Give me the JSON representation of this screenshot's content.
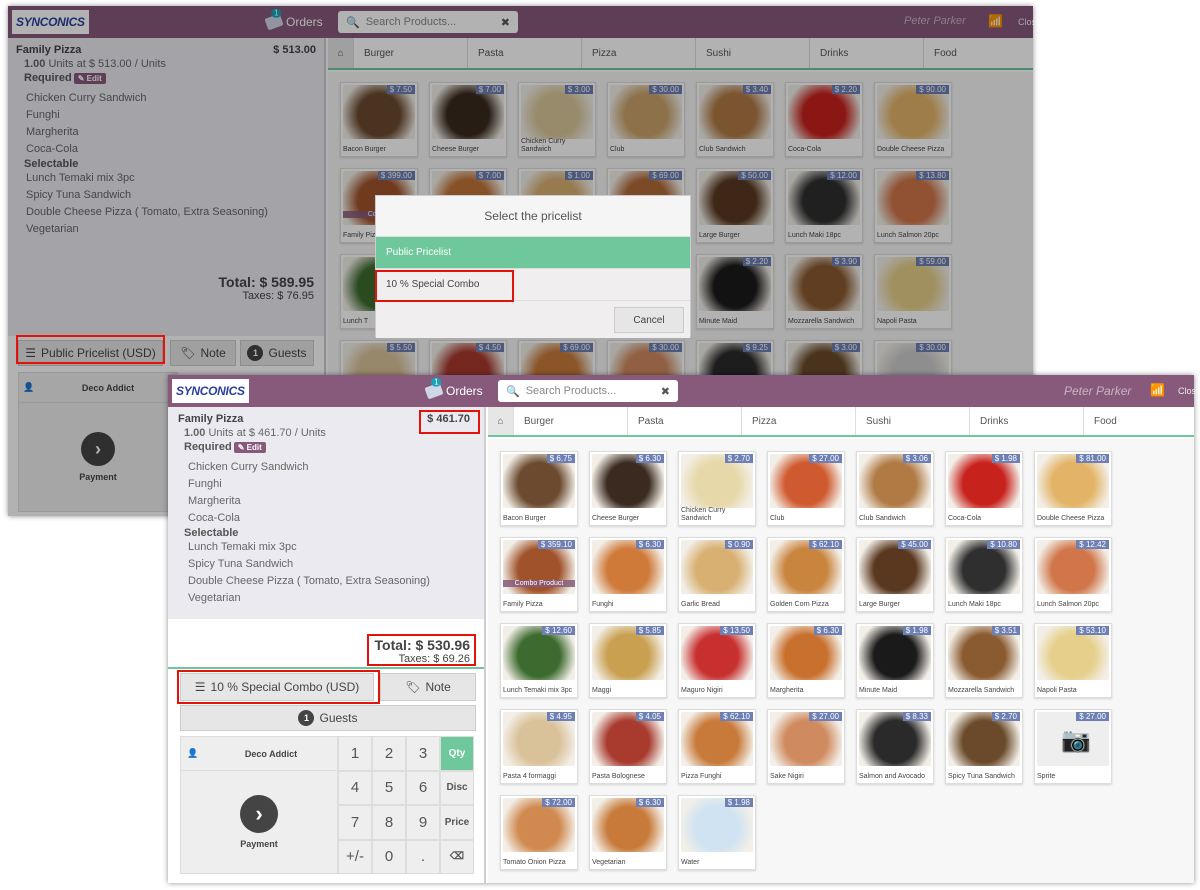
{
  "back": {
    "logo": "SYNCONICS",
    "orders": "Orders",
    "orders_badge": "1",
    "search_placeholder": "Search Products...",
    "user": "Peter Parker",
    "close": "Clos",
    "line": {
      "name": "Family Pizza",
      "price": "$ 513.00",
      "qty": "1.00",
      "units": " Units at $ 513.00 / Units"
    },
    "required": "Required",
    "edit": "Edit",
    "req_items": [
      "Chicken Curry Sandwich",
      "Funghi",
      "Margherita",
      "Coca-Cola"
    ],
    "selectable": "Selectable",
    "sel_items": [
      "Lunch Temaki mix 3pc",
      "Spicy Tuna Sandwich",
      "Double Cheese Pizza ( Tomato, Extra Seasoning)",
      "Vegetarian"
    ],
    "total": "Total: $ 589.95",
    "taxes": "Taxes: $ 76.95",
    "pricelist_btn": "Public Pricelist (USD)",
    "note": "Note",
    "guests_count": "1",
    "guests": "Guests",
    "customer": "Deco Addict",
    "payment": "Payment",
    "categories": [
      "Burger",
      "Pasta",
      "Pizza",
      "Sushi",
      "Drinks",
      "Food"
    ],
    "products": [
      {
        "name": "Bacon Burger",
        "price": "$ 7.50",
        "color": "#6b4a2f"
      },
      {
        "name": "Cheese Burger",
        "price": "$ 7.00",
        "color": "#3a2a1f"
      },
      {
        "name": "Chicken Curry Sandwich",
        "price": "$ 3.00",
        "color": "#d8c89a"
      },
      {
        "name": "Club",
        "price": "$ 30.00",
        "color": "#c9a36a"
      },
      {
        "name": "Club Sandwich",
        "price": "$ 3.40",
        "color": "#b07a45"
      },
      {
        "name": "Coca-Cola",
        "price": "$ 2.20",
        "color": "#c8221d"
      },
      {
        "name": "Double Cheese Pizza",
        "price": "$ 90.00",
        "color": "#e3b467"
      },
      {
        "name": "Family Pizza",
        "price": "$ 399.00",
        "color": "#a0532b",
        "combo": "Combo"
      },
      {
        "name": "",
        "price": "$ 7.00",
        "color": "#c27438"
      },
      {
        "name": "",
        "price": "$ 1.00",
        "color": "#d8b072"
      },
      {
        "name": "",
        "price": "$ 69.00",
        "color": "#b36a3a"
      },
      {
        "name": "Large Burger",
        "price": "$ 50.00",
        "color": "#5a3820"
      },
      {
        "name": "Lunch Maki 18pc",
        "price": "$ 12.00",
        "color": "#2f2f2f"
      },
      {
        "name": "Lunch Salmon 20pc",
        "price": "$ 13.80",
        "color": "#d0764a"
      },
      {
        "name": "Lunch T",
        "price": "",
        "color": "#3d6b2f"
      },
      {
        "name": "",
        "price": "",
        "color": "#c0a070"
      },
      {
        "name": "",
        "price": "",
        "color": "#c87a3a"
      },
      {
        "name": "",
        "price": "",
        "color": "#b85a35"
      },
      {
        "name": "Minute Maid",
        "price": "$ 2.20",
        "color": "#1a1a1a"
      },
      {
        "name": "Mozzarella Sandwich",
        "price": "$ 3.90",
        "color": "#8a5a30"
      },
      {
        "name": "Napoli Pasta",
        "price": "$ 59.00",
        "color": "#e6cf8a"
      },
      {
        "name": "",
        "price": "$ 5.50",
        "color": "#d9c29a"
      },
      {
        "name": "",
        "price": "$ 4.50",
        "color": "#a83a2e"
      },
      {
        "name": "",
        "price": "$ 69.00",
        "color": "#c87a3a"
      },
      {
        "name": "",
        "price": "$ 30.00",
        "color": "#d08a60"
      },
      {
        "name": "",
        "price": "$ 9.25",
        "color": "#2a2a2a"
      },
      {
        "name": "",
        "price": "$ 3.00",
        "color": "#6a4a2a"
      },
      {
        "name": "",
        "price": "$ 30.00",
        "color": "#cccccc"
      }
    ],
    "dialog": {
      "title": "Select the pricelist",
      "options": [
        "Public Pricelist",
        "10 % Special Combo"
      ],
      "cancel": "Cancel"
    }
  },
  "front": {
    "logo": "SYNCONICS",
    "orders": "Orders",
    "orders_badge": "1",
    "search_placeholder": "Search Products...",
    "user": "Peter Parker",
    "close": "Clos",
    "line": {
      "name": "Family Pizza",
      "price": "$ 461.70",
      "qty": "1.00",
      "units": " Units at $ 461.70 / Units"
    },
    "required": "Required",
    "edit": "Edit",
    "req_items": [
      "Chicken Curry Sandwich",
      "Funghi",
      "Margherita",
      "Coca-Cola"
    ],
    "selectable": "Selectable",
    "sel_items": [
      "Lunch Temaki mix 3pc",
      "Spicy Tuna Sandwich",
      "Double Cheese Pizza ( Tomato, Extra Seasoning)",
      "Vegetarian"
    ],
    "total": "Total: $ 530.96",
    "taxes": "Taxes: $ 69.26",
    "pricelist_btn": "10 % Special Combo (USD)",
    "note": "Note",
    "guests_count": "1",
    "guests": "Guests",
    "customer": "Deco Addict",
    "payment": "Payment",
    "numpad": [
      "1",
      "2",
      "3",
      "Qty",
      "4",
      "5",
      "6",
      "Disc",
      "7",
      "8",
      "9",
      "Price",
      "+/-",
      "0",
      ".",
      "⌫"
    ],
    "categories": [
      "Burger",
      "Pasta",
      "Pizza",
      "Sushi",
      "Drinks",
      "Food"
    ],
    "products": [
      {
        "name": "Bacon Burger",
        "price": "$ 6.75",
        "color": "#6b4a2f"
      },
      {
        "name": "Cheese Burger",
        "price": "$ 6.30",
        "color": "#3a2a1f"
      },
      {
        "name": "Chicken Curry Sandwich",
        "price": "$ 2.70",
        "color": "#e6d8a8"
      },
      {
        "name": "Club",
        "price": "$ 27.00",
        "color": "#d05a30"
      },
      {
        "name": "Club Sandwich",
        "price": "$ 3.06",
        "color": "#b07a45"
      },
      {
        "name": "Coca-Cola",
        "price": "$ 1.98",
        "color": "#c8221d"
      },
      {
        "name": "Double Cheese Pizza",
        "price": "$ 81.00",
        "color": "#e3b467"
      },
      {
        "name": "Family Pizza",
        "price": "$ 359.10",
        "color": "#a0532b",
        "combo": "Combo Product"
      },
      {
        "name": "Funghi",
        "price": "$ 6.30",
        "color": "#d07a3a"
      },
      {
        "name": "Garlic Bread",
        "price": "$ 0.90",
        "color": "#d8b072"
      },
      {
        "name": "Golden Corn Pizza",
        "price": "$ 62.10",
        "color": "#c9843e"
      },
      {
        "name": "Large Burger",
        "price": "$ 45.00",
        "color": "#5a3820"
      },
      {
        "name": "Lunch Maki 18pc",
        "price": "$ 10.80",
        "color": "#2f2f2f"
      },
      {
        "name": "Lunch Salmon 20pc",
        "price": "$ 12.42",
        "color": "#d0764a"
      },
      {
        "name": "Lunch Temaki mix 3pc",
        "price": "$ 12.60",
        "color": "#3d6b2f"
      },
      {
        "name": "Maggi",
        "price": "$ 5.85",
        "color": "#c9a050"
      },
      {
        "name": "Maguro Nigiri",
        "price": "$ 13.50",
        "color": "#c83030"
      },
      {
        "name": "Margherita",
        "price": "$ 6.30",
        "color": "#c8702e"
      },
      {
        "name": "Minute Maid",
        "price": "$ 1.98",
        "color": "#1a1a1a"
      },
      {
        "name": "Mozzarella Sandwich",
        "price": "$ 3.51",
        "color": "#8a5a30"
      },
      {
        "name": "Napoli Pasta",
        "price": "$ 53.10",
        "color": "#e6cf8a"
      },
      {
        "name": "Pasta 4 formaggi",
        "price": "$ 4.95",
        "color": "#d9c29a"
      },
      {
        "name": "Pasta Bolognese",
        "price": "$ 4.05",
        "color": "#a83a2e"
      },
      {
        "name": "Pizza Funghi",
        "price": "$ 62.10",
        "color": "#c87a3a"
      },
      {
        "name": "Sake Nigiri",
        "price": "$ 27.00",
        "color": "#d08a60"
      },
      {
        "name": "Salmon and Avocado",
        "price": "$ 8.33",
        "color": "#2a2a2a"
      },
      {
        "name": "Spicy Tuna Sandwich",
        "price": "$ 2.70",
        "color": "#6a4a2a"
      },
      {
        "name": "Sprite",
        "price": "$ 27.00",
        "color": "#e8e8e8",
        "placeholder": true
      },
      {
        "name": "Tomato Onion Pizza",
        "price": "$ 72.00",
        "color": "#d08a50"
      },
      {
        "name": "Vegetarian",
        "price": "$ 6.30",
        "color": "#c87a3a"
      },
      {
        "name": "Water",
        "price": "$ 1.98",
        "color": "#cfe3f2"
      }
    ]
  }
}
